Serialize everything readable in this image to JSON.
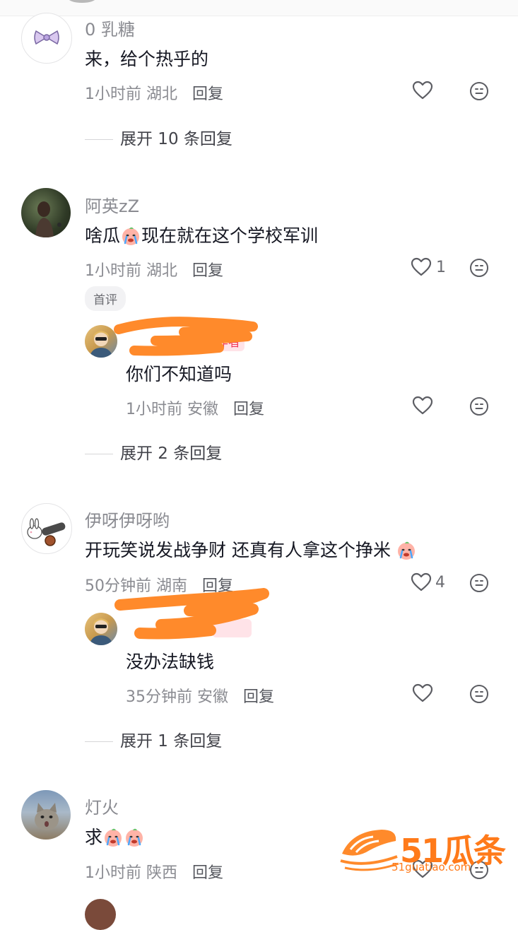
{
  "comments": [
    {
      "user": "0 乳糖",
      "text": "来，给个热乎的",
      "time": "1小时前",
      "location": "湖北",
      "reply_label": "回复",
      "likes": "",
      "expand": "展开 10 条回复"
    },
    {
      "user": "阿英zZ",
      "text_before": "啥瓜",
      "text_after": "现在就在这个学校军训",
      "time": "1小时前",
      "location": "湖北",
      "reply_label": "回复",
      "likes": "1",
      "badge": "首评",
      "sub_reply": {
        "author_tag": "作者",
        "text": "你们不知道吗",
        "time": "1小时前",
        "location": "安徽",
        "reply_label": "回复"
      },
      "expand": "展开 2 条回复"
    },
    {
      "user": "伊呀伊呀哟",
      "text": "开玩笑说发战争财 还真有人拿这个挣米",
      "time": "50分钟前",
      "location": "湖南",
      "reply_label": "回复",
      "likes": "4",
      "sub_reply": {
        "text": "没办法缺钱",
        "time": "35分钟前",
        "location": "安徽",
        "reply_label": "回复"
      },
      "expand": "展开 1 条回复"
    },
    {
      "user": "灯火",
      "text": "求",
      "time": "1小时前",
      "location": "陕西",
      "reply_label": "回复"
    }
  ],
  "watermark": {
    "brand": "51瓜条",
    "domain": "51guatiao.com"
  },
  "icons": {
    "like": "heart-outline-icon",
    "more": "face-icon",
    "emoji": "crying-peach-emoji"
  },
  "colors": {
    "accent_author": "#f23a5b",
    "scribble": "#ff8a2b",
    "watermark": "#ff7a1a"
  }
}
